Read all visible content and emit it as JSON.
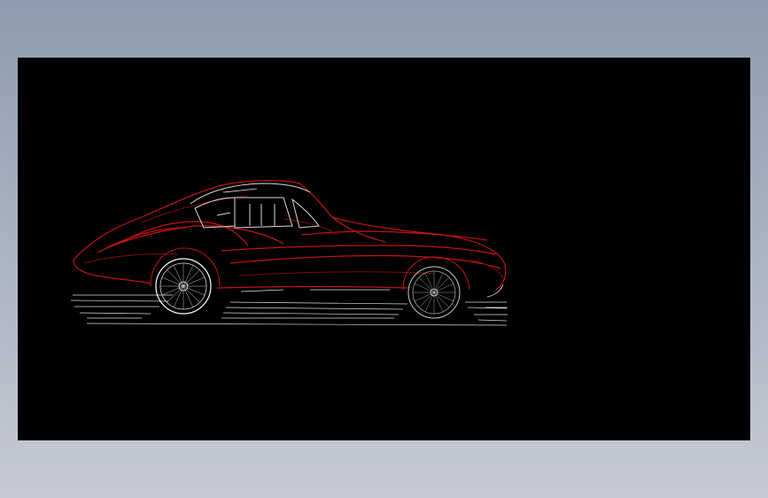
{
  "colors": {
    "background_top": "#8e9caf",
    "background_bottom": "#c6cad4",
    "canvas": "#000000",
    "body_outline_red": "#c41414",
    "body_outline_dark_red": "#7a0c0c",
    "highlight_white": "#ffffff",
    "interior_outline": "#d8d8d8"
  },
  "drawing": {
    "subject": "car-side-outline",
    "style": "edge-detected wireframe"
  }
}
